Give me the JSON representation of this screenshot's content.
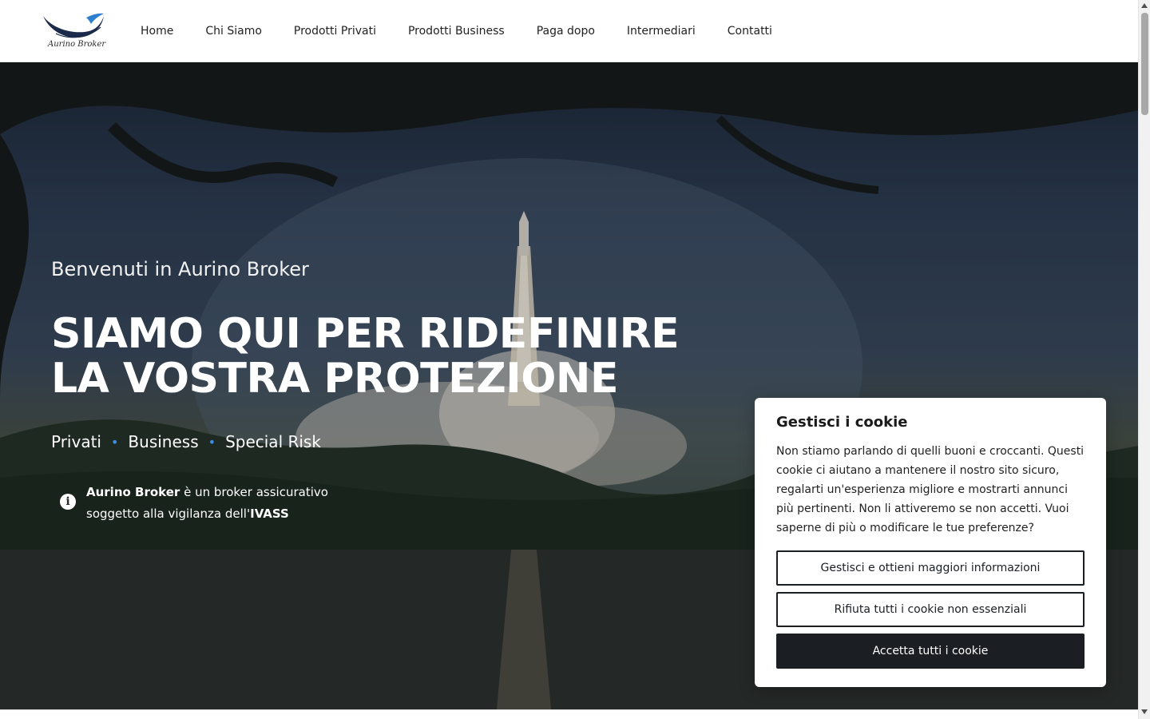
{
  "brand": {
    "logo_text": "Aurino Broker",
    "logo_icon": "wave-logo-icon",
    "accent": "#1f5fa8"
  },
  "nav": {
    "items": [
      {
        "label": "Home"
      },
      {
        "label": "Chi Siamo"
      },
      {
        "label": "Prodotti Privati"
      },
      {
        "label": "Prodotti Business"
      },
      {
        "label": "Paga dopo"
      },
      {
        "label": "Intermediari"
      },
      {
        "label": "Contatti"
      }
    ]
  },
  "hero": {
    "welcome": "Benvenuti in Aurino Broker",
    "headline": "SIAMO QUI PER RIDEFINIRE LA VOSTRA PROTEZIONE",
    "segments": [
      "Privati",
      "Business",
      "Special Risk"
    ],
    "segment_dot_color": "#3b8fe6",
    "notice": {
      "icon": "info-icon",
      "brand": "Aurino Broker",
      "text_1": " è un broker assicurativo soggetto alla vigilanza dell'",
      "authority": "IVASS"
    }
  },
  "cookie": {
    "title": "Gestisci i cookie",
    "body": "Non stiamo parlando di quelli buoni e croccanti. Questi cookie ci aiutano a mantenere il nostro sito sicuro, regalarti un'esperienza migliore e mostrarti annunci più pertinenti. Non li attiveremo se non accetti. Vuoi saperne di più o modificare le tue preferenze?",
    "manage_label": "Gestisci e ottieni maggiori informazioni",
    "reject_label": "Rifiuta tutti i cookie non essenziali",
    "accept_label": "Accetta tutti i cookie",
    "accept_bg": "#1b1f24"
  }
}
